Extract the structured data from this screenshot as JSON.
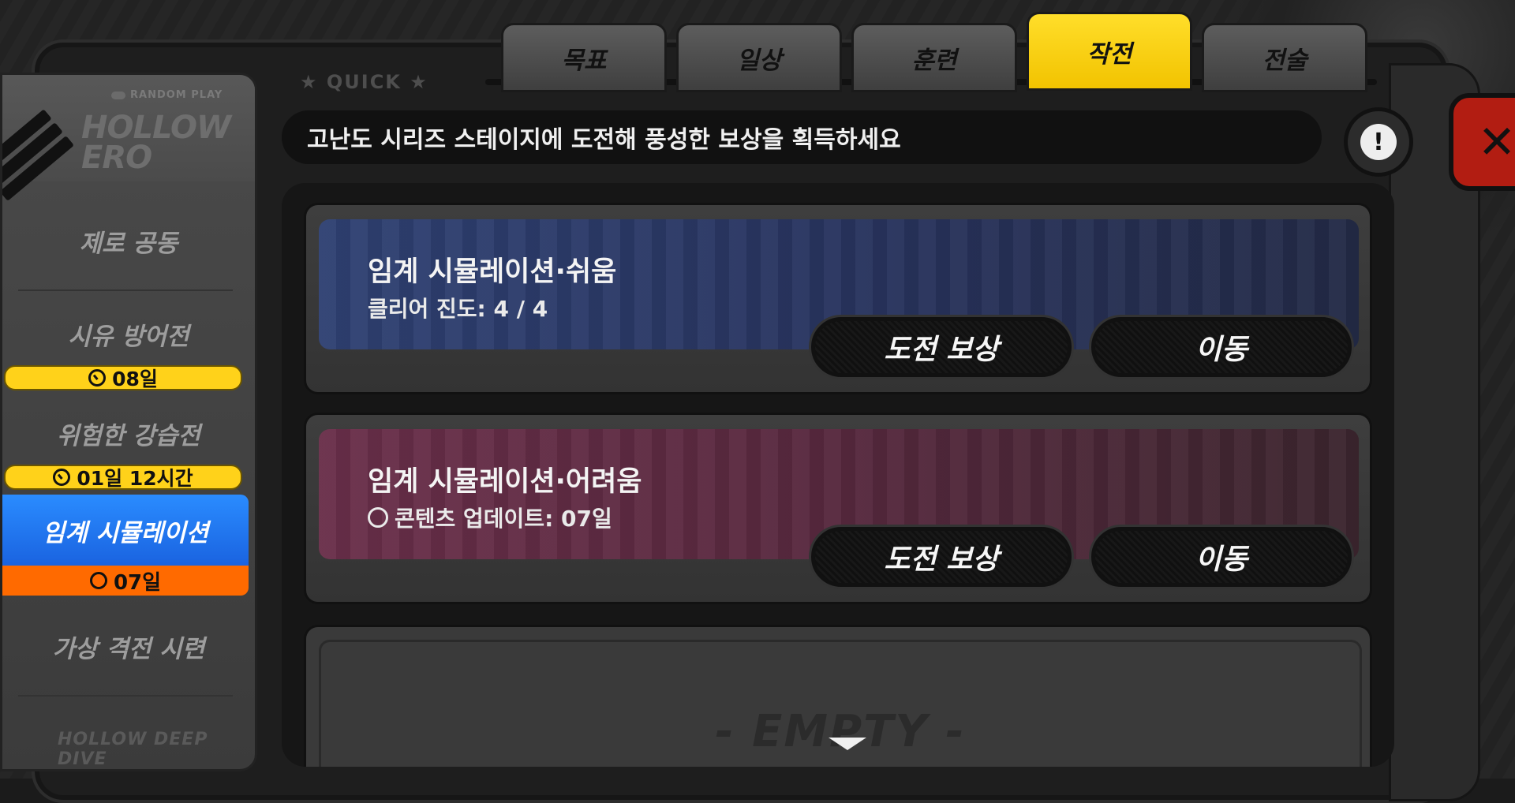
{
  "tabs": [
    {
      "label": "목표",
      "active": false
    },
    {
      "label": "일상",
      "active": false
    },
    {
      "label": "훈련",
      "active": false
    },
    {
      "label": "작전",
      "active": true
    },
    {
      "label": "전술",
      "active": false
    }
  ],
  "quick_label": "★ QUICK ★",
  "sidebar": {
    "random_play": "RANDOM PLAY",
    "logo_line1": "HOLLOW",
    "logo_line2": "ERO",
    "items": [
      {
        "label": "제로 공동"
      },
      {
        "label": "시유 방어전",
        "badge": "08일"
      },
      {
        "label": "위험한 강습전",
        "badge": "01일 12시간"
      },
      {
        "label": "임계 시뮬레이션",
        "badge": "07일",
        "active": true
      },
      {
        "label": "가상 격전 시련"
      }
    ],
    "bottom_text": "HOLLOW DEEP DIVE"
  },
  "description": "고난도 시리즈 스테이지에 도전해 풍성한 보상을 획득하세요",
  "info_icon": "!",
  "close_icon": "✕",
  "cards": [
    {
      "title": "임계 시뮬레이션·쉬움",
      "subtitle": "클리어 진도: 4 / 4",
      "reward_button": "도전 보상",
      "go_button": "이동"
    },
    {
      "title": "임계 시뮬레이션·어려움",
      "subtitle": "콘텐츠 업데이트: 07일",
      "reward_button": "도전 보상",
      "go_button": "이동"
    }
  ],
  "empty_label": "- EMPTY -",
  "colors": {
    "active_tab": "#ffd21a",
    "active_sidebar": "#1f78ff",
    "badge_yellow": "#ffd21a",
    "badge_orange": "#ff6a00",
    "close_red": "#b21d12"
  }
}
